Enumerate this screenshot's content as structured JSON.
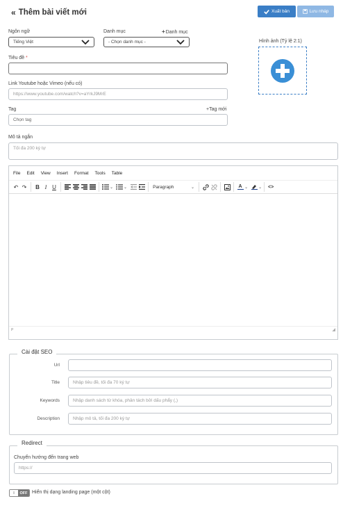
{
  "header": {
    "back_icon": "double-chevron-left-icon",
    "title": "Thêm bài viết mới",
    "publish_label": "Xuất bản",
    "draft_label": "Lưu nháp",
    "colors": {
      "publish": "#3a7ec6",
      "draft": "#8fb8e4",
      "accent": "#3a7ec6"
    }
  },
  "form": {
    "language_label": "Ngôn ngữ",
    "language_value": "Tiếng Việt",
    "category_label": "Danh mục",
    "category_add": "Danh mục",
    "category_value": "- Chọn danh mục -",
    "image_label": "Hình ảnh (Tỷ lệ 2:1)",
    "title_label": "Tiêu đề",
    "title_required": "*",
    "youtube_label": "Link Youtube hoặc Vimeo (nếu có)",
    "youtube_placeholder": "https://www.youtube.com/watch?v=aYrkJ9MrE",
    "tag_label": "Tag",
    "tag_add": "+Tag mới",
    "tag_placeholder": "Chọn tag",
    "desc_label": "Mô tả ngắn",
    "desc_placeholder": "Tối đa 200 ký tự"
  },
  "editor": {
    "menu": [
      "File",
      "Edit",
      "View",
      "Insert",
      "Format",
      "Tools",
      "Table"
    ],
    "paragraph": "Paragraph",
    "status_path": "P"
  },
  "seo": {
    "legend": "Cài đặt SEO",
    "url_label": "Url",
    "title_label": "Title",
    "title_placeholder": "Nhập tiêu đề, tối đa 70 ký tự",
    "keywords_label": "Keywords",
    "keywords_placeholder": "Nhập danh sách từ khóa, phân tách bởi dấu phẩy (,)",
    "description_label": "Description",
    "description_placeholder": "Nhập mô tả, tối đa 200 ký tự"
  },
  "redirect": {
    "legend": "Redirect",
    "label": "Chuyển hướng đến trang web",
    "placeholder": "https://"
  },
  "landing": {
    "toggle_on": "II",
    "toggle_off": "OFF",
    "label": "Hiển thị dạng landing page (một cột)"
  }
}
